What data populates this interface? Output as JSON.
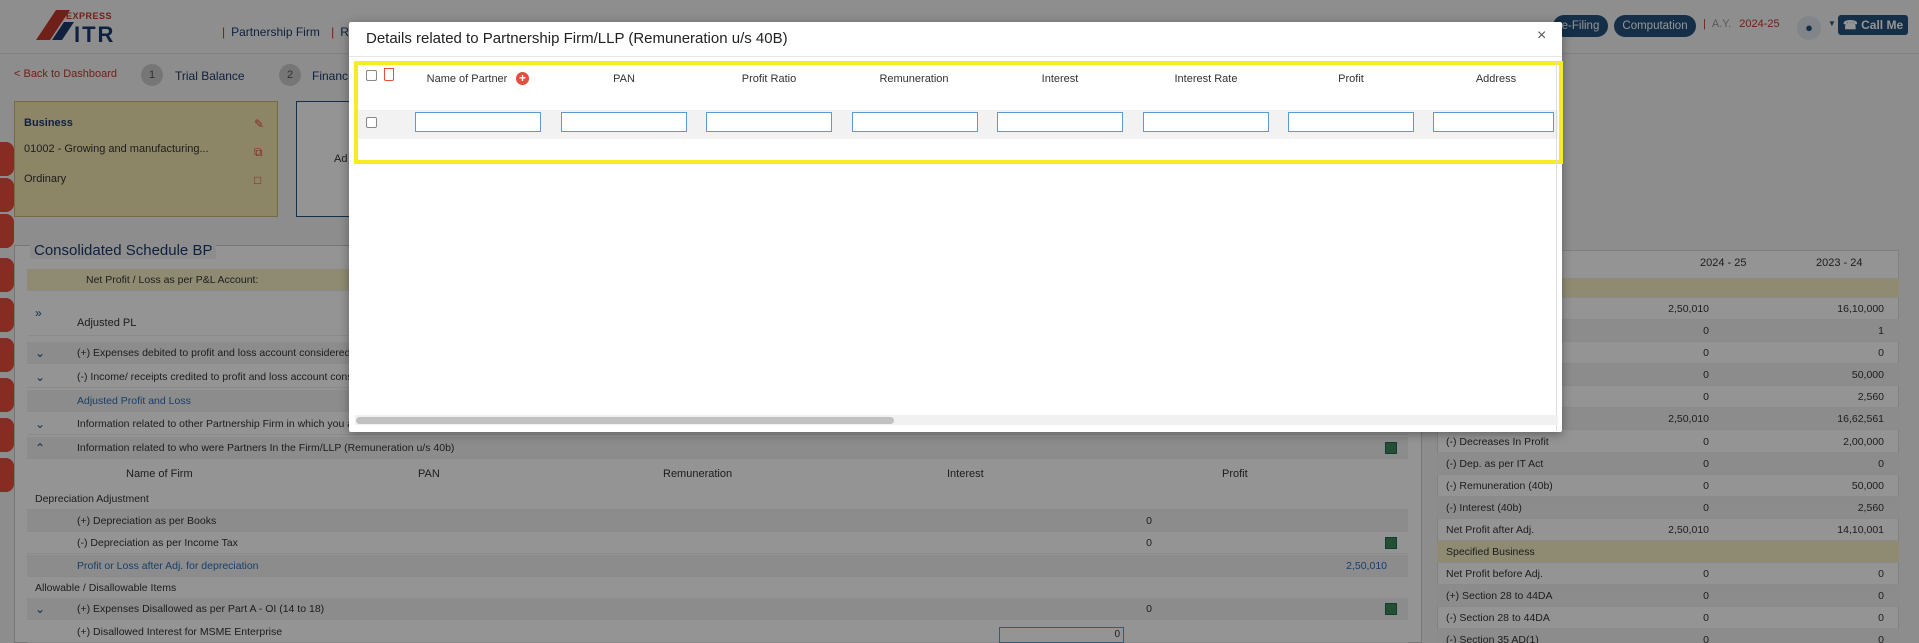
{
  "header": {
    "logo_top": "EXPRESS",
    "logo_main": "ITR",
    "nav": [
      "Partnership Firm",
      "R"
    ],
    "efiling_label": "e-Filing",
    "computation_label": "Computation",
    "ay_label": "A.Y.",
    "ay_value": "2024-25",
    "call_label": "Call Me"
  },
  "steps": {
    "back_label": "< Back to Dashboard",
    "items": [
      {
        "num": "1",
        "label": "Trial Balance"
      },
      {
        "num": "2",
        "label": "Financ"
      }
    ]
  },
  "business": {
    "title": "Business",
    "code": "01002 - Growing and manufacturing...",
    "type": "Ordinary",
    "partial": "Ad"
  },
  "schedule": {
    "title": "Consolidated Schedule BP",
    "net_profit_label": "Net Profit / Loss as per P&L Account:",
    "adjusted_pl": "Adjusted PL",
    "rows": [
      "(+) Expenses debited to profit and loss account considered u",
      "(-) Income/ receipts credited to profit and loss account consi",
      "Adjusted Profit and Loss",
      "Information related to other Partnership Firm in which you a",
      "Information related to who were Partners In the Firm/LLP (Remuneration u/s 40b)"
    ],
    "partner_cols": [
      "Name of Firm",
      "PAN",
      "Remuneration",
      "Interest",
      "Profit"
    ],
    "dep_header": "Depreciation Adjustment",
    "dep_books": "(+) Depreciation as per Books",
    "dep_books_val": "0",
    "dep_it": "(-) Depreciation as per Income Tax",
    "dep_it_val": "0",
    "pl_after_dep": "Profit or Loss after Adj. for depreciation",
    "pl_after_dep_val": "2,50,010",
    "allow_header": "Allowable / Disallowable Items",
    "exp_disallowed": "(+) Expenses Disallowed as per Part A - OI (14 to 18)",
    "exp_disallowed_val": "0",
    "msme": "(+) Disallowed Interest for MSME Enterprise",
    "msme_val": "0"
  },
  "right": {
    "col1": "2024 - 25",
    "col2": "2023 - 24",
    "rows": [
      {
        "label": "",
        "v1": "2,50,010",
        "v2": "16,10,000"
      },
      {
        "label": "",
        "v1": "0",
        "v2": "1"
      },
      {
        "label": "",
        "v1": "0",
        "v2": "0"
      },
      {
        "label": "",
        "v1": "0",
        "v2": "50,000"
      },
      {
        "label": "",
        "v1": "0",
        "v2": "2,560"
      },
      {
        "label": "",
        "v1": "2,50,010",
        "v2": "16,62,561"
      },
      {
        "label": "(-) Decreases In Profit",
        "v1": "0",
        "v2": "2,00,000"
      },
      {
        "label": "(-) Dep. as per IT Act",
        "v1": "0",
        "v2": "0"
      },
      {
        "label": "(-) Remuneration (40b)",
        "v1": "0",
        "v2": "50,000"
      },
      {
        "label": "(-) Interest (40b)",
        "v1": "0",
        "v2": "2,560"
      },
      {
        "label": "Net Profit after Adj.",
        "v1": "2,50,010",
        "v2": "14,10,001"
      },
      {
        "label": "Specified Business",
        "v1": "",
        "v2": ""
      },
      {
        "label": "Net Profit before Adj.",
        "v1": "0",
        "v2": "0"
      },
      {
        "label": "(+) Section 28 to 44DA",
        "v1": "0",
        "v2": "0"
      },
      {
        "label": "(-) Section 28 to 44DA",
        "v1": "0",
        "v2": "0"
      },
      {
        "label": "(-) Section 35 AD(1)",
        "v1": "0",
        "v2": "0"
      }
    ]
  },
  "modal": {
    "title": "Details related to Partnership Firm/LLP (Remuneration u/s 40B)",
    "close": "×",
    "columns": [
      "Name of Partner",
      "PAN",
      "Profit Ratio",
      "Remuneration",
      "Interest",
      "Interest Rate",
      "Profit",
      "Address"
    ]
  }
}
